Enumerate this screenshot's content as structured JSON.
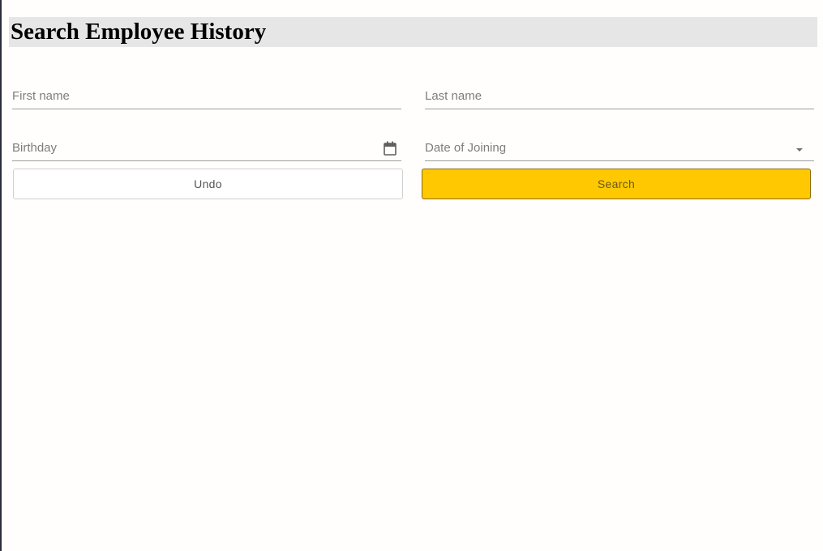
{
  "page": {
    "title": "Search Employee History"
  },
  "form": {
    "first_name": {
      "value": "",
      "placeholder": "First name"
    },
    "last_name": {
      "value": "",
      "placeholder": "Last name"
    },
    "birthday": {
      "value": "",
      "placeholder": "Birthday",
      "icon": "calendar-icon"
    },
    "date_of_joining": {
      "value": "",
      "placeholder": "Date of Joining",
      "icon": "chevron-down-icon"
    }
  },
  "actions": {
    "undo_label": "Undo",
    "search_label": "Search"
  },
  "colors": {
    "search_button_bg": "#ffc800",
    "title_bar_bg": "#e6e6e6"
  }
}
